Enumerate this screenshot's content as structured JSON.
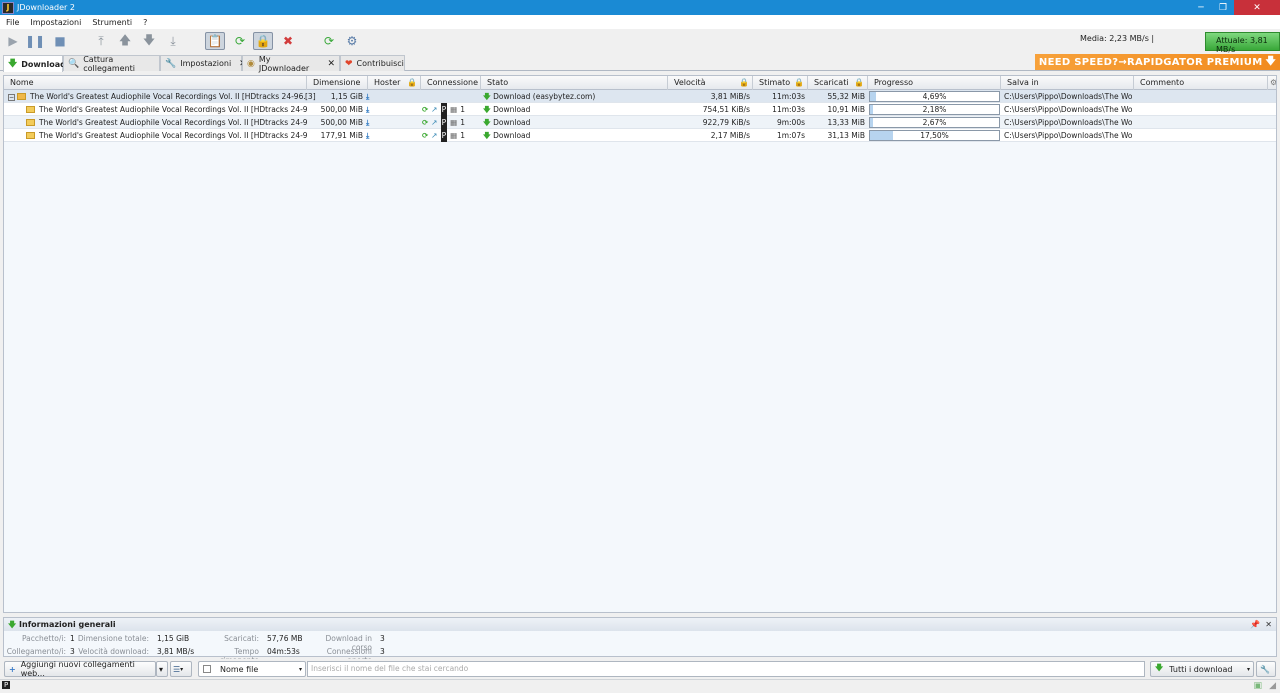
{
  "window": {
    "title": "JDownloader 2"
  },
  "menu": [
    "File",
    "Impostazioni",
    "Strumenti",
    "?"
  ],
  "speed": {
    "avg": "Media: 2,23 MB/s |",
    "current": "Attuale: 3,81 MB/s"
  },
  "tabs": [
    {
      "label": "Download"
    },
    {
      "label": "Cattura collegamenti"
    },
    {
      "label": "Impostazioni"
    },
    {
      "label": "My JDownloader"
    },
    {
      "label": "Contribuisci"
    }
  ],
  "promo": "NEED SPEED?→RAPIDGATOR PREMIUM",
  "columns": [
    "Nome",
    "Dimensione",
    "Hoster",
    "Connessione",
    "Stato",
    "Velocità",
    "Stimato",
    "Scaricati",
    "Progresso",
    "Salva in",
    "Commento"
  ],
  "package": {
    "name": "The World's Greatest Audiophile Vocal Recordings Vol. II [HDtracks 24-96...",
    "count": "[3]",
    "size": "1,15 GiB",
    "status": "Download (easybytez.com)",
    "speed": "3,81 MiB/s",
    "eta": "11m:03s",
    "loaded": "55,32 MiB",
    "progress_text": "4,69%",
    "progress": 4.69,
    "path": "C:\\Users\\Pippo\\Downloads\\The Wo..."
  },
  "files": [
    {
      "name": "The World's Greatest Audiophile Vocal Recordings Vol. II [HDtracks 24-96,16...",
      "size": "500,00 MiB",
      "conn": "1",
      "status": "Download",
      "speed": "754,51 KiB/s",
      "eta": "11m:03s",
      "loaded": "10,91 MiB",
      "progress_text": "2,18%",
      "progress": 2.18,
      "path": "C:\\Users\\Pippo\\Downloads\\The Wo..."
    },
    {
      "name": "The World's Greatest Audiophile Vocal Recordings Vol. II [HDtracks 24-96,16...",
      "size": "500,00 MiB",
      "conn": "1",
      "status": "Download",
      "speed": "922,79 KiB/s",
      "eta": "9m:00s",
      "loaded": "13,33 MiB",
      "progress_text": "2,67%",
      "progress": 2.67,
      "path": "C:\\Users\\Pippo\\Downloads\\The Wo..."
    },
    {
      "name": "The World's Greatest Audiophile Vocal Recordings Vol. II [HDtracks 24-96,16...",
      "size": "177,91 MiB",
      "conn": "1",
      "status": "Download",
      "speed": "2,17 MiB/s",
      "eta": "1m:07s",
      "loaded": "31,13 MiB",
      "progress_text": "17,50%",
      "progress": 17.5,
      "path": "C:\\Users\\Pippo\\Downloads\\The Wo..."
    }
  ],
  "info": {
    "title": "Informazioni generali",
    "k_packages": "Pacchetto/i:",
    "v_packages": "1",
    "k_links": "Collegamento/i:",
    "v_links": "3",
    "k_total": "Dimensione totale:",
    "v_total": "1,15 GiB",
    "k_dlspeed": "Velocità download:",
    "v_dlspeed": "3,81 MB/s",
    "k_loaded": "Scaricati:",
    "v_loaded": "57,76 MB",
    "k_remaining": "Tempo rimanente",
    "v_remaining": "04m:53s",
    "k_running": "Download in corso",
    "v_running": "3",
    "k_open": "Connessioni aperte",
    "v_open": "3"
  },
  "bottom": {
    "add_links": "Aggiungi nuovi collegamenti web...",
    "filter_label": "Nome file",
    "search_placeholder": "Inserisci il nome del file che stai cercando",
    "all_downloads": "Tutti i download"
  }
}
